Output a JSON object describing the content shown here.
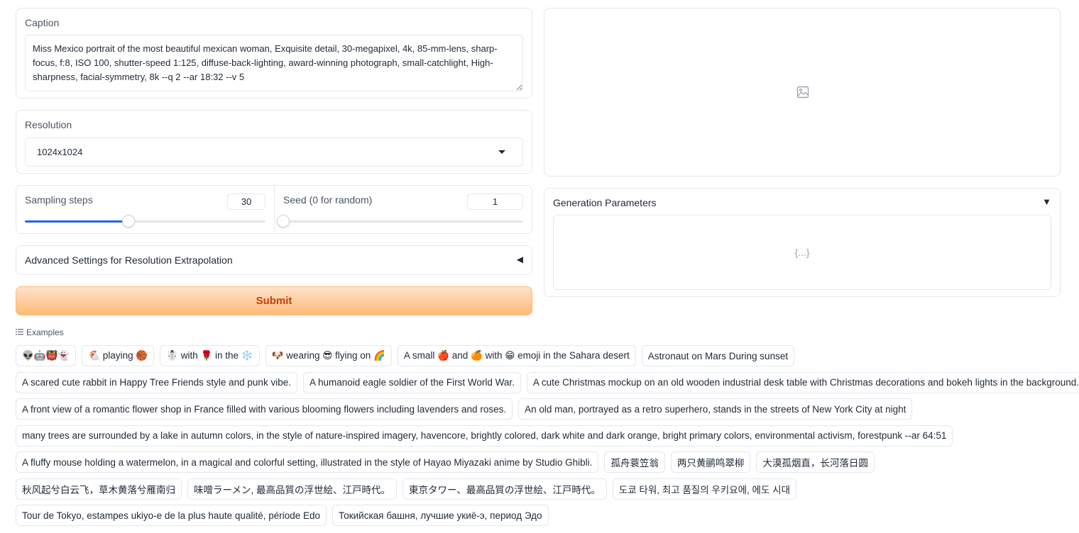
{
  "caption": {
    "label": "Caption",
    "value": "Miss Mexico portrait of the most beautiful mexican woman, Exquisite detail, 30-megapixel, 4k, 85-mm-lens, sharp-focus, f:8, ISO 100, shutter-speed 1:125, diffuse-back-lighting, award-winning photograph, small-catchlight, High-sharpness, facial-symmetry, 8k --q 2 --ar 18:32 --v 5"
  },
  "resolution": {
    "label": "Resolution",
    "selected": "1024x1024"
  },
  "sampling_steps": {
    "label": "Sampling steps",
    "value": "30",
    "fraction": 0.43
  },
  "seed": {
    "label": "Seed (0 for random)",
    "value": "1",
    "fraction": 0.0
  },
  "advanced": {
    "label": "Advanced Settings for Resolution Extrapolation",
    "collapsed_icon": "◀"
  },
  "submit": {
    "label": "Submit"
  },
  "output_image": {
    "icon": "image-placeholder-icon"
  },
  "generation_params": {
    "label": "Generation Parameters",
    "toggle_icon": "▼",
    "json_placeholder": "{...}"
  },
  "examples": {
    "label": "Examples",
    "rows": [
      [
        "👽🤖👹👻",
        "🐔 playing 🏀",
        "☃️ with 🌹 in the ❄️",
        "🐶 wearing 😎 flying on 🌈",
        "A small 🍎 and 🍊 with 😁 emoji in the Sahara desert",
        "Astronaut on Mars During sunset"
      ],
      [
        "A scared cute rabbit in Happy Tree Friends style and punk vibe.",
        "A humanoid eagle soldier of the First World War.",
        "A cute Christmas mockup on an old wooden industrial desk table with Christmas decorations and bokeh lights in the background."
      ],
      [
        "A front view of a romantic flower shop in France filled with various blooming flowers including lavenders and roses.",
        "An old man, portrayed as a retro superhero, stands in the streets of New York City at night"
      ],
      [
        "many trees are surrounded by a lake in autumn colors, in the style of nature-inspired imagery, havencore, brightly colored, dark white and dark orange, bright primary colors, environmental activism, forestpunk --ar 64:51"
      ],
      [
        "A fluffy mouse holding a watermelon, in a magical and colorful setting, illustrated in the style of Hayao Miyazaki anime by Studio Ghibli.",
        "孤舟蓑笠翁",
        "两只黄鹂鸣翠柳",
        "大漠孤烟直，长河落日圆"
      ],
      [
        "秋风起兮白云飞，草木黄落兮雁南归",
        "味噌ラーメン, 最高品質の浮世絵、江戸時代。",
        "東京タワー、最高品質の浮世絵、江戸時代。",
        "도쿄 타워, 최고 품질의 우키요에, 에도 시대"
      ],
      [
        "Tour de Tokyo, estampes ukiyo-e de la plus haute qualité, période Edo",
        "Токийская башня, лучшие укиё-э, период Эдо"
      ]
    ]
  }
}
